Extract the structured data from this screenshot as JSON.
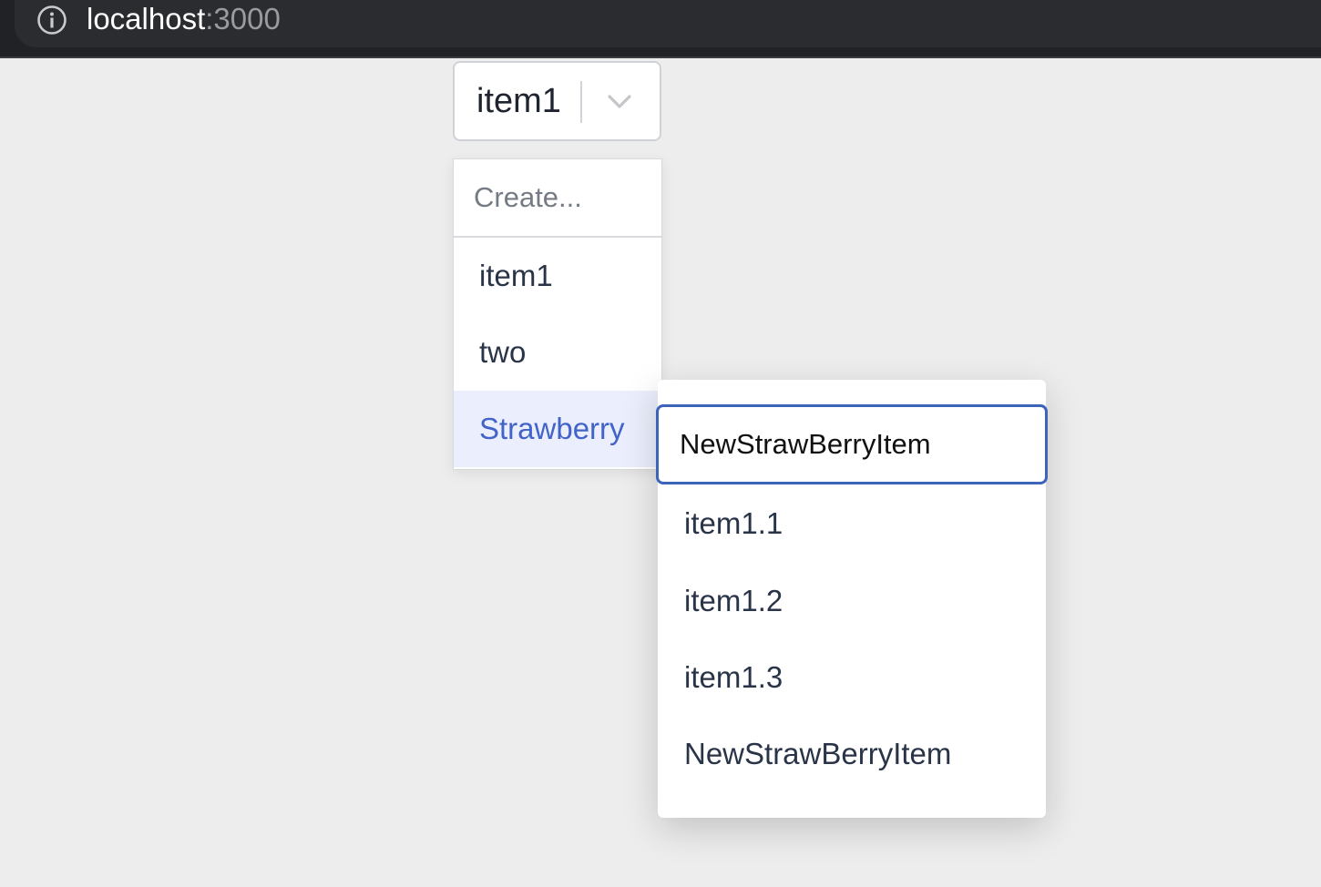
{
  "browser": {
    "url_host": "localhost",
    "url_port": ":3000",
    "icons": {
      "info": "info-circle-icon"
    }
  },
  "select": {
    "value": "item1",
    "icons": {
      "toggle": "chevron-down-icon"
    }
  },
  "menu": {
    "create_placeholder": "Create...",
    "options": [
      {
        "label": "item1"
      },
      {
        "label": "two"
      },
      {
        "label": "Strawberry",
        "selected": true
      }
    ]
  },
  "submenu": {
    "input_value": "NewStrawBerryItem",
    "options": [
      {
        "label": "item1.1"
      },
      {
        "label": "item1.2"
      },
      {
        "label": "item1.3"
      },
      {
        "label": "NewStrawBerryItem"
      }
    ]
  },
  "colors": {
    "selected_text": "#4263c8",
    "selected_bg": "#ebeefc",
    "focus_border": "#3c64b8"
  }
}
